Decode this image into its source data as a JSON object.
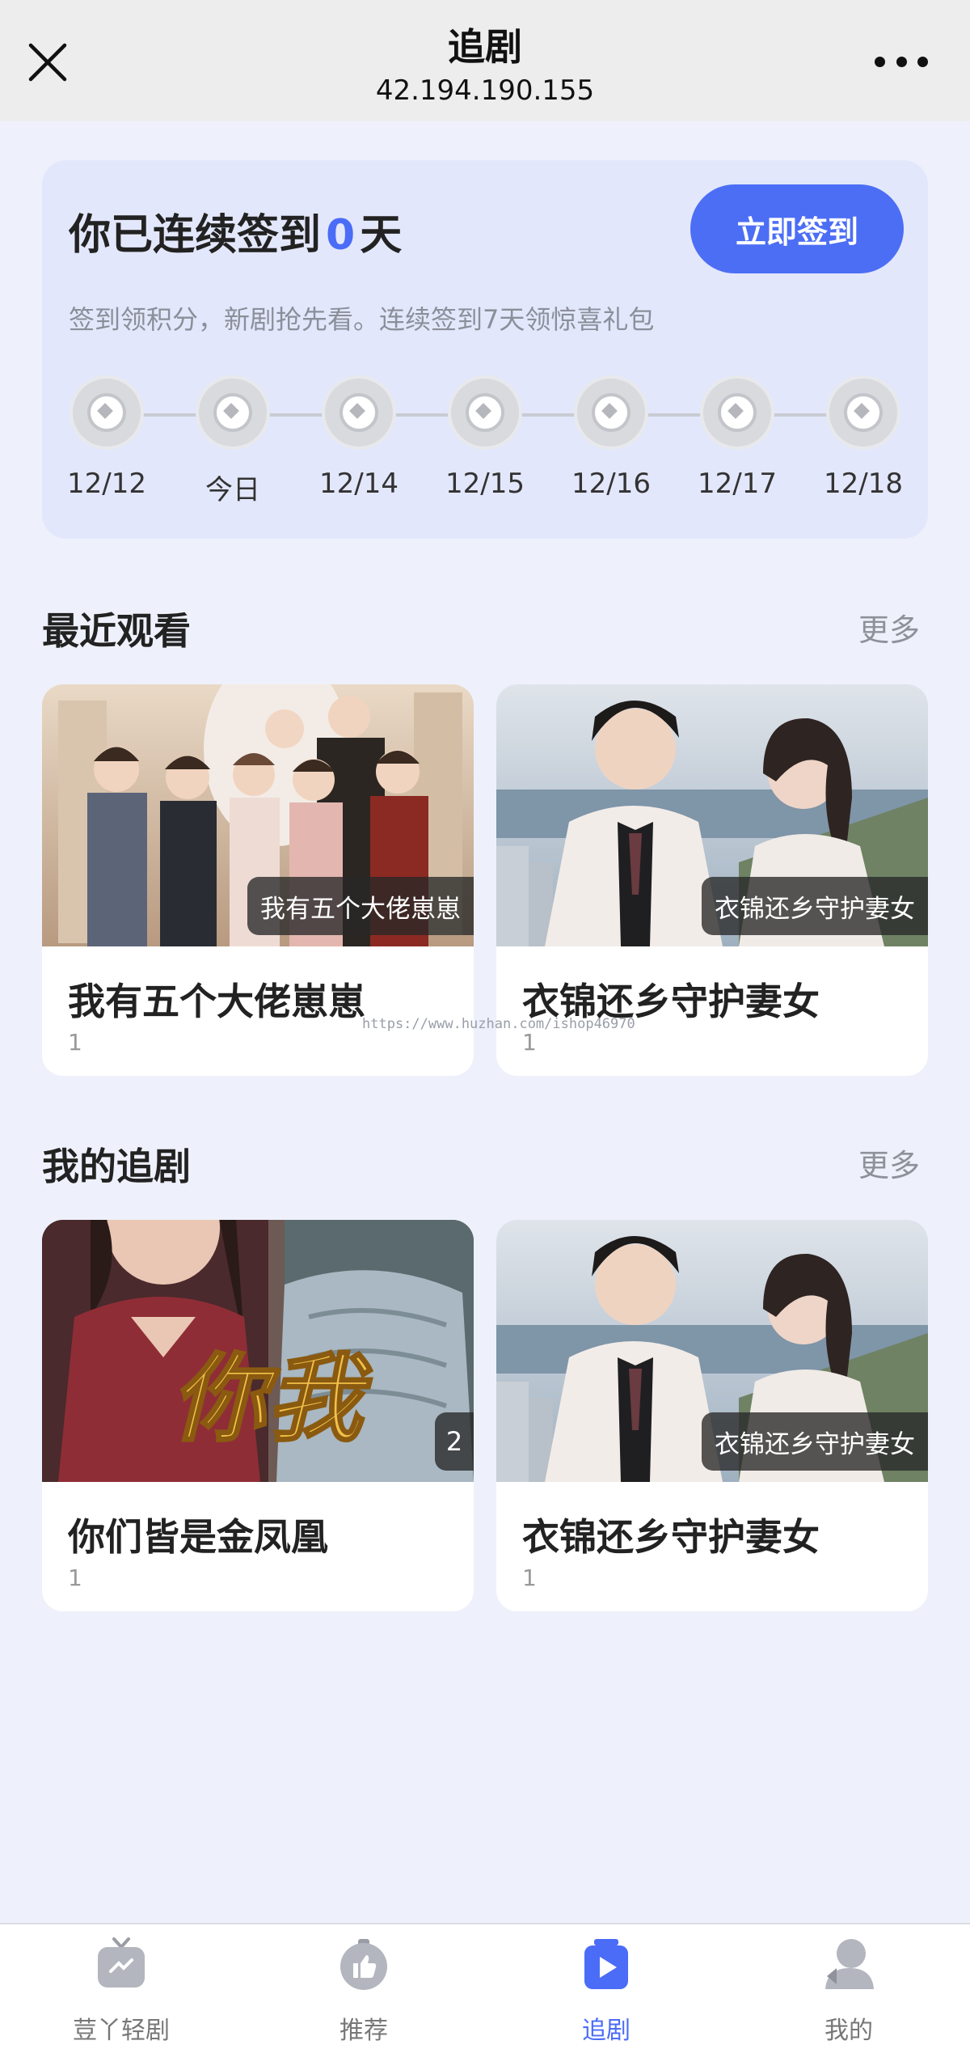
{
  "header": {
    "title": "追剧",
    "subtitle": "42.194.190.155"
  },
  "signin": {
    "title_prefix": "你已连续签到",
    "days": "0",
    "title_suffix": "天",
    "button": "立即签到",
    "description": "签到领积分，新剧抢先看。连续签到7天领惊喜礼包",
    "dates": [
      "12/12",
      "今日",
      "12/14",
      "12/15",
      "12/16",
      "12/17",
      "12/18"
    ]
  },
  "recent": {
    "title": "最近观看",
    "more": "更多",
    "items": [
      {
        "title": "我有五个大佬崽崽",
        "tag": "我有五个大佬崽崽",
        "count": "1"
      },
      {
        "title": "衣锦还乡守护妻女",
        "tag": "衣锦还乡守护妻女",
        "count": "1"
      }
    ]
  },
  "watermark": "https://www.huzhan.com/ishop46970",
  "following": {
    "title": "我的追剧",
    "more": "更多",
    "items": [
      {
        "title": "你们皆是金凤凰",
        "badge": "2",
        "count": "1",
        "poster_text": "你我"
      },
      {
        "title": "衣锦还乡守护妻女",
        "tag": "衣锦还乡守护妻女",
        "count": "1"
      }
    ]
  },
  "tabbar": {
    "active_color": "#4a6cf7",
    "items": [
      {
        "label": "荳丫轻剧",
        "icon": "tv-icon"
      },
      {
        "label": "推荐",
        "icon": "thumbs-up-icon"
      },
      {
        "label": "追剧",
        "icon": "play-icon"
      },
      {
        "label": "我的",
        "icon": "user-icon"
      }
    ]
  }
}
